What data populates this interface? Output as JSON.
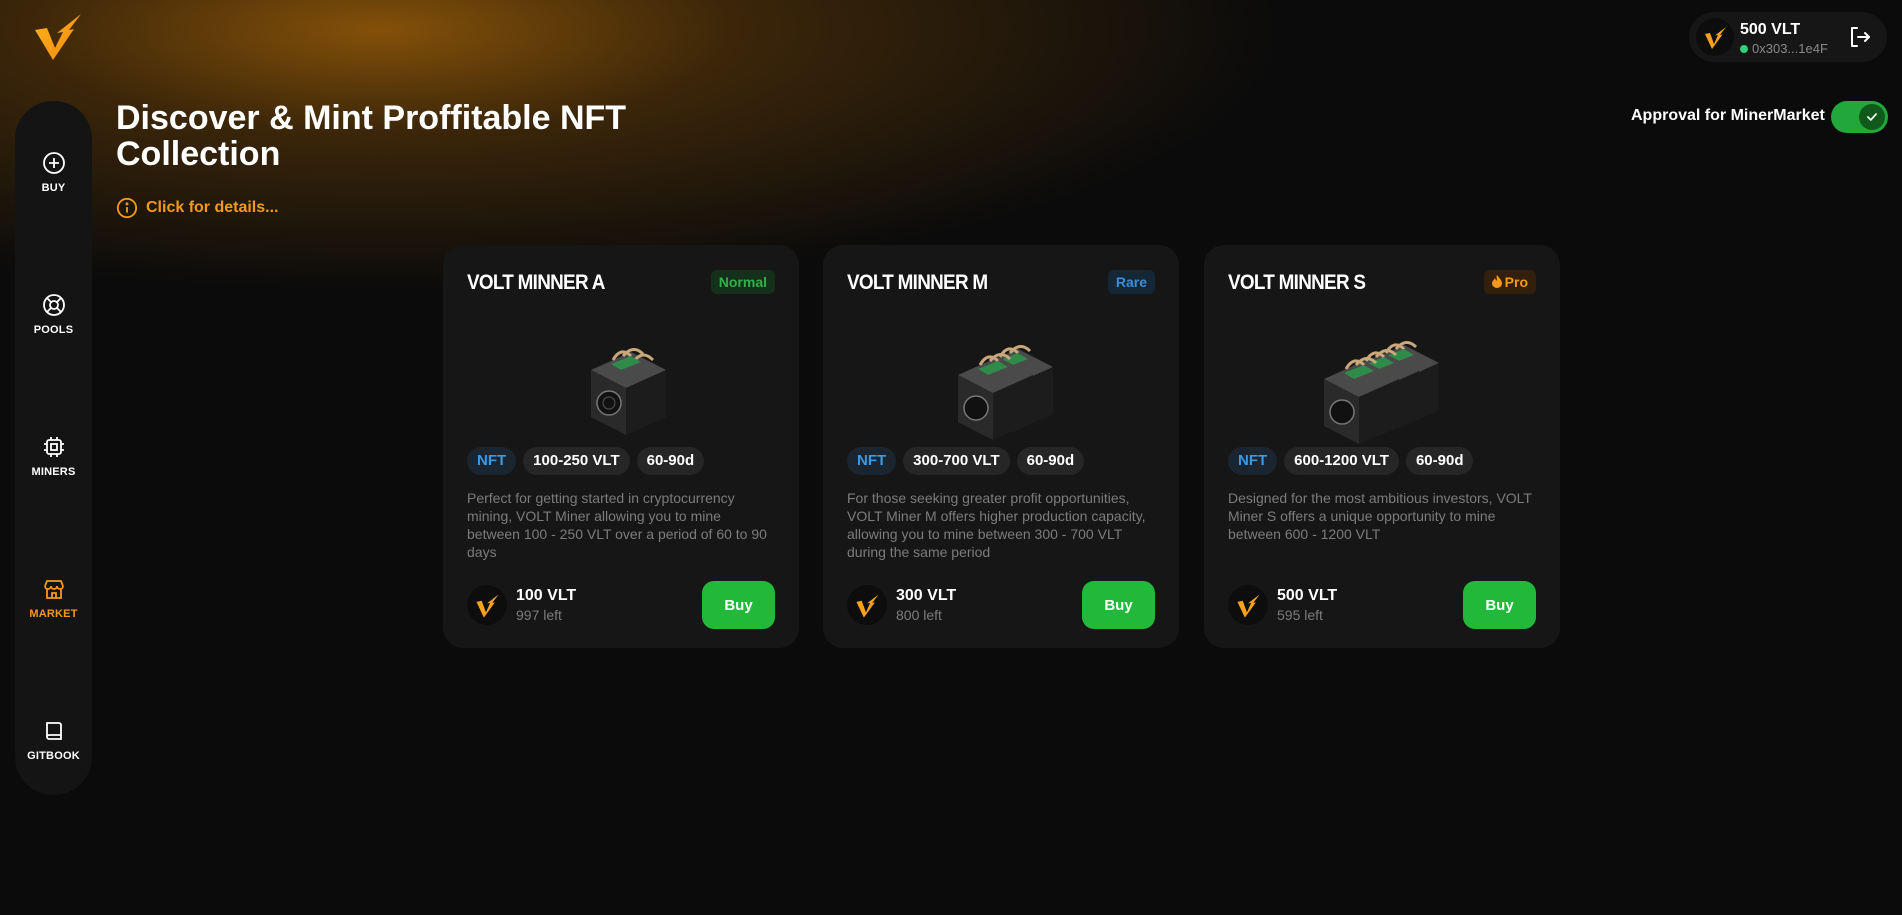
{
  "wallet": {
    "balance": "500 VLT",
    "address": "0x303...1e4F"
  },
  "approval": {
    "label": "Approval for MinerMarket",
    "enabled": true
  },
  "page": {
    "title": "Discover & Mint Proffitable NFT Collection",
    "details_link": "Click for details..."
  },
  "sidebar": {
    "items": [
      {
        "label": "BUY",
        "icon": "plus-circle-icon"
      },
      {
        "label": "POOLS",
        "icon": "lifebuoy-icon"
      },
      {
        "label": "MINERS",
        "icon": "chip-icon"
      },
      {
        "label": "MARKET",
        "icon": "store-icon",
        "active": true
      },
      {
        "label": "GITBOOK",
        "icon": "book-icon"
      }
    ]
  },
  "cards": [
    {
      "name": "VOLT MINNER A",
      "badge": "Normal",
      "tags": [
        "NFT",
        "100-250 VLT",
        "60-90d"
      ],
      "description": "Perfect for getting started in cryptocurrency mining, VOLT Miner allowing you to mine between 100 - 250 VLT over a period of 60 to 90 days",
      "price": "100 VLT",
      "left": "997 left",
      "buy_label": "Buy"
    },
    {
      "name": "VOLT MINNER M",
      "badge": "Rare",
      "tags": [
        "NFT",
        "300-700 VLT",
        "60-90d"
      ],
      "description": "For those seeking greater profit opportunities, VOLT Miner M offers higher production capacity, allowing you to mine between 300 - 700 VLT during the same period",
      "price": "300 VLT",
      "left": "800 left",
      "buy_label": "Buy"
    },
    {
      "name": "VOLT MINNER S",
      "badge": "Pro",
      "tags": [
        "NFT",
        "600-1200 VLT",
        "60-90d"
      ],
      "description": "Designed for the most ambitious investors, VOLT Miner S offers a unique opportunity to mine between 600 - 1200 VLT",
      "price": "500 VLT",
      "left": "595 left",
      "buy_label": "Buy"
    }
  ],
  "colors": {
    "accent": "#f39a1b",
    "buy": "#22b83a",
    "toggle": "#22a83a"
  }
}
